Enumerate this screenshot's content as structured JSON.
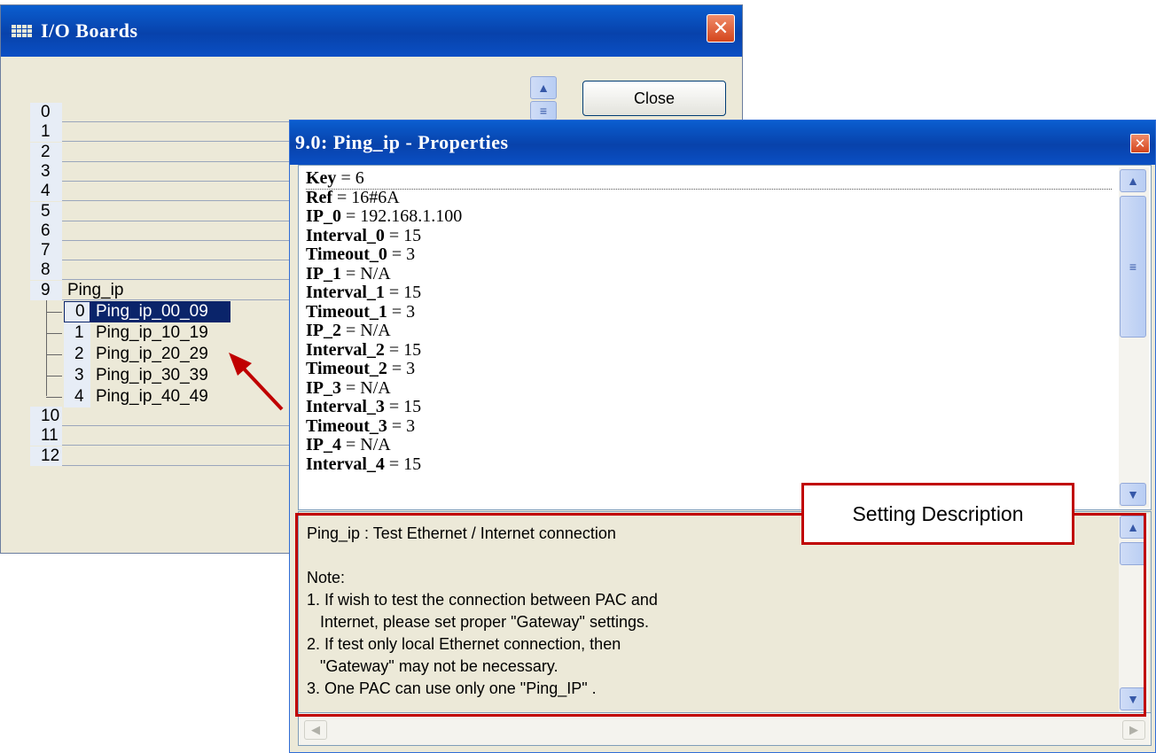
{
  "io_window": {
    "title": "I/O Boards",
    "close_label": "Close",
    "slots": [
      "0",
      "1",
      "2",
      "3",
      "4",
      "5",
      "6",
      "7",
      "8"
    ],
    "slot9": {
      "num": "9",
      "label": "Ping_ip"
    },
    "children": [
      {
        "num": "0",
        "label": "Ping_ip_00_09"
      },
      {
        "num": "1",
        "label": "Ping_ip_10_19"
      },
      {
        "num": "2",
        "label": "Ping_ip_20_29"
      },
      {
        "num": "3",
        "label": "Ping_ip_30_39"
      },
      {
        "num": "4",
        "label": "Ping_ip_40_49"
      }
    ],
    "slots_after": [
      "10",
      "11",
      "12"
    ]
  },
  "props_window": {
    "title": "9.0: Ping_ip - Properties",
    "properties": [
      {
        "key": "Key",
        "value": "6"
      },
      {
        "key": "Ref",
        "value": "16#6A"
      },
      {
        "key": "IP_0",
        "value": "192.168.1.100"
      },
      {
        "key": "Interval_0",
        "value": "15"
      },
      {
        "key": "Timeout_0",
        "value": "3"
      },
      {
        "key": "IP_1",
        "value": "N/A"
      },
      {
        "key": "Interval_1",
        "value": "15"
      },
      {
        "key": "Timeout_1",
        "value": "3"
      },
      {
        "key": "IP_2",
        "value": "N/A"
      },
      {
        "key": "Interval_2",
        "value": "15"
      },
      {
        "key": "Timeout_2",
        "value": "3"
      },
      {
        "key": "IP_3",
        "value": "N/A"
      },
      {
        "key": "Interval_3",
        "value": "15"
      },
      {
        "key": "Timeout_3",
        "value": "3"
      },
      {
        "key": "IP_4",
        "value": "N/A"
      },
      {
        "key": "Interval_4",
        "value": "15"
      }
    ],
    "description_lines": [
      "Ping_ip : Test Ethernet / Internet connection",
      "",
      "Note:",
      "1. If wish to test the connection between PAC and",
      "   Internet, please set proper \"Gateway\" settings.",
      "2. If test only local Ethernet connection, then",
      "   \"Gateway\" may not be necessary.",
      "3. One PAC can use only one \"Ping_IP\" ."
    ]
  },
  "annotation": {
    "callout_text": "Setting Description",
    "color": "#c00000"
  },
  "colors": {
    "titlebar": "#0842ab",
    "selection": "#0a246a",
    "dialog_bg": "#ece9d8"
  }
}
